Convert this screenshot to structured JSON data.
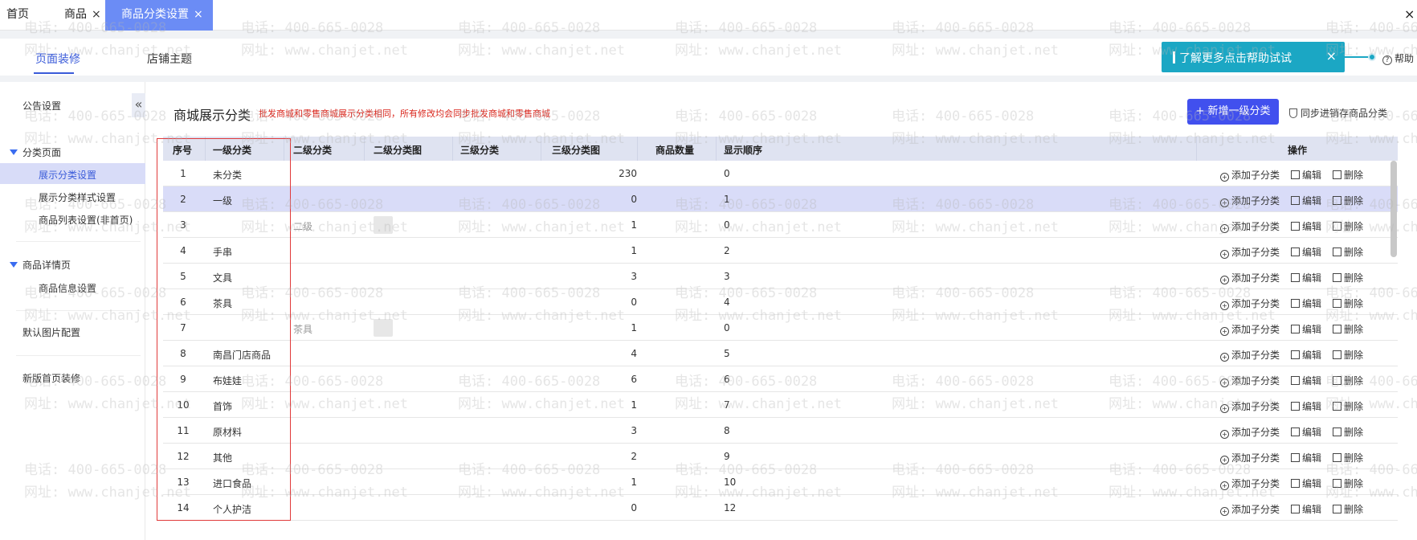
{
  "tabs": [
    {
      "label": "首页",
      "closable": false
    },
    {
      "label": "商品",
      "closable": true
    },
    {
      "label": "商品分类设置",
      "closable": true,
      "active": true
    }
  ],
  "close_symbol": "×",
  "subtabs": [
    "页面装修",
    "店铺主题"
  ],
  "help_tip": {
    "text": "了解更多点击帮助试试",
    "close": "×",
    "help_label": "帮助"
  },
  "sidebar": {
    "collapse": "«",
    "notice": "公告设置",
    "category_group": "分类页面",
    "category_items": [
      "展示分类设置",
      "展示分类样式设置",
      "商品列表设置(非首页)"
    ],
    "detail_group": "商品详情页",
    "detail_items": [
      "商品信息设置"
    ],
    "default_image": "默认图片配置",
    "new_home": "新版首页装修"
  },
  "main": {
    "title": "商城展示分类",
    "note": "批发商城和零售商城展示分类相同，所有修改均会同步批发商城和零售商城",
    "add_button": "+ 新增一级分类",
    "sync_label": "同步进销存商品分类"
  },
  "table": {
    "headers": [
      "序号",
      "一级分类",
      "二级分类",
      "二级分类图",
      "三级分类",
      "三级分类图",
      "商品数量",
      "显示顺序",
      "操作"
    ],
    "op_labels": {
      "add_child": "添加子分类",
      "edit": "编辑",
      "delete": "删除"
    },
    "rows": [
      {
        "idx": "1",
        "l1": "未分类",
        "l2": "",
        "img": false,
        "qty": "230",
        "order": "0",
        "highlight": false
      },
      {
        "idx": "2",
        "l1": "一级",
        "l2": "",
        "img": false,
        "qty": "0",
        "order": "1",
        "highlight": true
      },
      {
        "idx": "3",
        "l1": "",
        "l2": "二级",
        "img": true,
        "qty": "1",
        "order": "0",
        "highlight": false
      },
      {
        "idx": "4",
        "l1": "手串",
        "l2": "",
        "img": false,
        "qty": "1",
        "order": "2",
        "highlight": false
      },
      {
        "idx": "5",
        "l1": "文具",
        "l2": "",
        "img": false,
        "qty": "3",
        "order": "3",
        "highlight": false
      },
      {
        "idx": "6",
        "l1": "茶具",
        "l2": "",
        "img": false,
        "qty": "0",
        "order": "4",
        "highlight": false
      },
      {
        "idx": "7",
        "l1": "",
        "l2": "茶具",
        "img": true,
        "qty": "1",
        "order": "0",
        "highlight": false
      },
      {
        "idx": "8",
        "l1": "南昌门店商品",
        "l2": "",
        "img": false,
        "qty": "4",
        "order": "5",
        "highlight": false
      },
      {
        "idx": "9",
        "l1": "布娃娃",
        "l2": "",
        "img": false,
        "qty": "6",
        "order": "6",
        "highlight": false
      },
      {
        "idx": "10",
        "l1": "首饰",
        "l2": "",
        "img": false,
        "qty": "1",
        "order": "7",
        "highlight": false
      },
      {
        "idx": "11",
        "l1": "原材料",
        "l2": "",
        "img": false,
        "qty": "3",
        "order": "8",
        "highlight": false
      },
      {
        "idx": "12",
        "l1": "其他",
        "l2": "",
        "img": false,
        "qty": "2",
        "order": "9",
        "highlight": false
      },
      {
        "idx": "13",
        "l1": "进口食品",
        "l2": "",
        "img": false,
        "qty": "1",
        "order": "10",
        "highlight": false
      },
      {
        "idx": "14",
        "l1": "个人护洁",
        "l2": "",
        "img": false,
        "qty": "0",
        "order": "12",
        "highlight": false
      }
    ]
  },
  "watermark": {
    "phone": "电话: 400-665-0028",
    "site": "网址: www.chanjet.net"
  },
  "colors": {
    "accent": "#4150ee",
    "tab_active": "#6b8cf5",
    "tip": "#1ba7c4",
    "note_red": "#d9261c",
    "highlight_row": "#d9dcf8"
  }
}
